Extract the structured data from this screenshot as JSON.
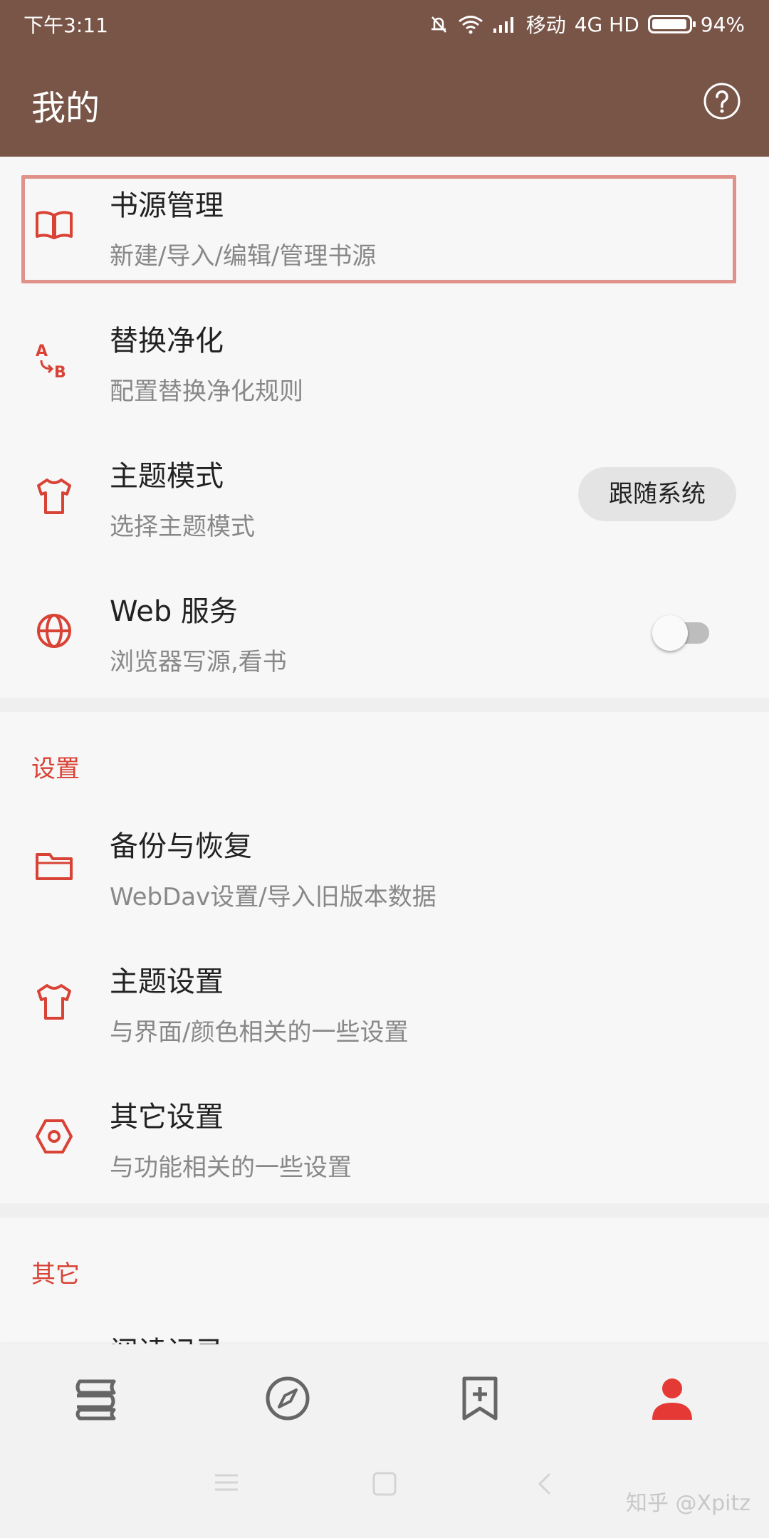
{
  "status_bar": {
    "time": "下午3:11",
    "carrier": "移动",
    "network": "4G HD",
    "battery": "94%"
  },
  "app_bar": {
    "title": "我的"
  },
  "items": [
    {
      "title": "书源管理",
      "subtitle": "新建/导入/编辑/管理书源",
      "icon": "book-icon"
    },
    {
      "title": "替换净化",
      "subtitle": "配置替换净化规则",
      "icon": "replace-ab-icon"
    },
    {
      "title": "主题模式",
      "subtitle": "选择主题模式",
      "icon": "shirt-icon",
      "value": "跟随系统"
    },
    {
      "title": "Web 服务",
      "subtitle": "浏览器写源,看书",
      "icon": "globe-icon",
      "toggle": false
    }
  ],
  "settings": {
    "header": "设置",
    "items": [
      {
        "title": "备份与恢复",
        "subtitle": "WebDav设置/导入旧版本数据",
        "icon": "folder-icon"
      },
      {
        "title": "主题设置",
        "subtitle": "与界面/颜色相关的一些设置",
        "icon": "shirt-icon"
      },
      {
        "title": "其它设置",
        "subtitle": "与功能相关的一些设置",
        "icon": "hexagon-settings-icon"
      }
    ]
  },
  "other": {
    "header": "其它",
    "peek_item": "阅读记录"
  },
  "bottom_nav": [
    "bookshelf-icon",
    "compass-icon",
    "bookmark-add-icon",
    "person-icon"
  ],
  "watermark": "知乎 @Xpitz",
  "colors": {
    "primary": "#795548",
    "accent": "#d84336",
    "background": "#f7f7f7"
  }
}
